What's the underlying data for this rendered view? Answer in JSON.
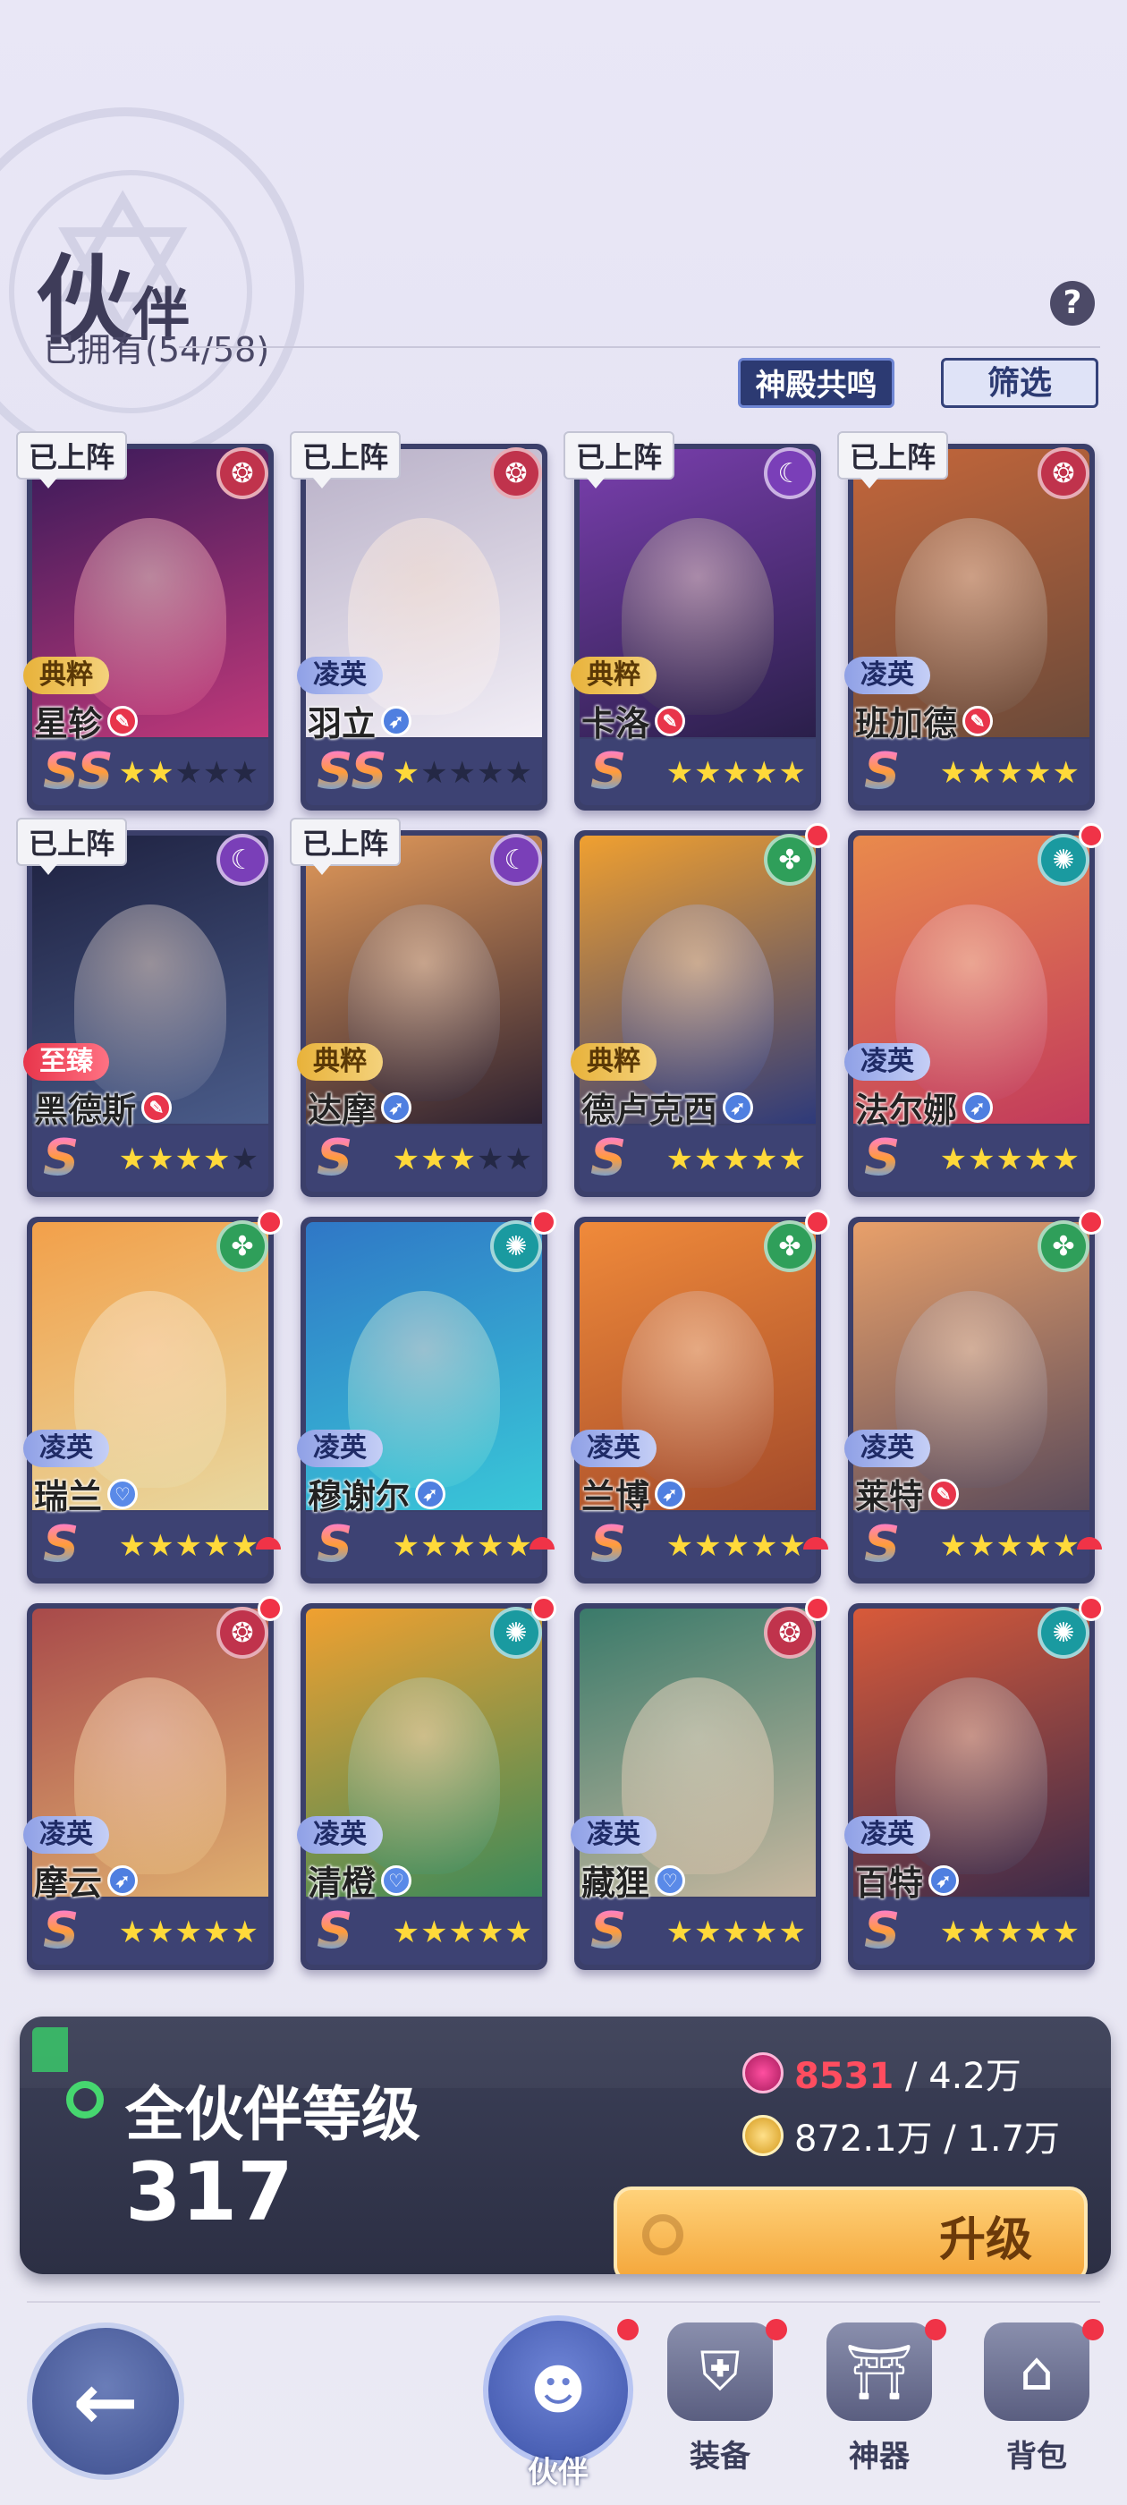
{
  "header": {
    "title_big": "伙",
    "title_small": "伴",
    "owned_label": "已拥有(54/58)",
    "temple_button": "神殿共鸣",
    "filter_button": "筛选",
    "help_icon": "?"
  },
  "deployed_label": "已上阵",
  "cards": [
    {
      "name": "星轸",
      "rank": "典粹",
      "rank_style": "gold",
      "deployed": true,
      "grade": "SS",
      "stars": 2,
      "max_stars": 5,
      "faction": "red",
      "role": "red",
      "red_dot": false,
      "art": [
        "#3a1a5a",
        "#c0397a"
      ]
    },
    {
      "name": "羽立",
      "rank": "凌英",
      "rank_style": "blue",
      "deployed": true,
      "grade": "SS",
      "stars": 1,
      "max_stars": 5,
      "faction": "red",
      "role": "blue",
      "red_dot": false,
      "art": [
        "#b9b1c8",
        "#f2eef6"
      ]
    },
    {
      "name": "卡洛",
      "rank": "典粹",
      "rank_style": "gold",
      "deployed": true,
      "grade": "S",
      "stars": 5,
      "max_stars": 5,
      "faction": "purple",
      "role": "red",
      "red_dot": false,
      "art": [
        "#7a3fae",
        "#2a1f4a"
      ]
    },
    {
      "name": "班加德",
      "rank": "凌英",
      "rank_style": "blue",
      "deployed": true,
      "grade": "S",
      "stars": 5,
      "max_stars": 5,
      "faction": "red",
      "role": "red",
      "red_dot": false,
      "art": [
        "#c4663a",
        "#6a4a3a"
      ]
    },
    {
      "name": "黑德斯",
      "rank": "至臻",
      "rank_style": "red",
      "deployed": true,
      "grade": "S",
      "stars": 4,
      "max_stars": 5,
      "faction": "purple",
      "role": "red",
      "red_dot": false,
      "art": [
        "#1e2140",
        "#4a5c8a"
      ]
    },
    {
      "name": "达摩",
      "rank": "典粹",
      "rank_style": "gold",
      "deployed": true,
      "grade": "S",
      "stars": 3,
      "max_stars": 5,
      "faction": "purple",
      "role": "blue",
      "red_dot": false,
      "art": [
        "#e39a5a",
        "#2c2030"
      ]
    },
    {
      "name": "德卢克西",
      "rank": "典粹",
      "rank_style": "gold",
      "deployed": false,
      "grade": "S",
      "stars": 5,
      "max_stars": 5,
      "faction": "green",
      "role": "blue",
      "red_dot": true,
      "art": [
        "#f0a030",
        "#2e3a7a"
      ]
    },
    {
      "name": "法尔娜",
      "rank": "凌英",
      "rank_style": "blue",
      "deployed": false,
      "grade": "S",
      "stars": 5,
      "max_stars": 5,
      "faction": "teal",
      "role": "blue",
      "red_dot": true,
      "art": [
        "#e98a4c",
        "#c23a5c"
      ]
    },
    {
      "name": "瑞兰",
      "rank": "凌英",
      "rank_style": "blue",
      "deployed": false,
      "grade": "S",
      "stars": 5,
      "max_stars": 5,
      "faction": "green",
      "role": "heart",
      "red_dot": true,
      "art": [
        "#f2a04a",
        "#e8d8a0"
      ]
    },
    {
      "name": "穆谢尔",
      "rank": "凌英",
      "rank_style": "blue",
      "deployed": false,
      "grade": "S",
      "stars": 5,
      "max_stars": 5,
      "faction": "teal",
      "role": "blue",
      "red_dot": true,
      "art": [
        "#2f77c6",
        "#39c8d8"
      ]
    },
    {
      "name": "兰博",
      "rank": "凌英",
      "rank_style": "blue",
      "deployed": false,
      "grade": "S",
      "stars": 5,
      "max_stars": 5,
      "faction": "green",
      "role": "blue",
      "red_dot": true,
      "art": [
        "#f08a3a",
        "#a34a2a"
      ]
    },
    {
      "name": "莱特",
      "rank": "凌英",
      "rank_style": "blue",
      "deployed": false,
      "grade": "S",
      "stars": 5,
      "max_stars": 5,
      "faction": "green",
      "role": "red",
      "red_dot": true,
      "art": [
        "#e8a06a",
        "#5a4a5a"
      ]
    },
    {
      "name": "摩云",
      "rank": "凌英",
      "rank_style": "blue",
      "deployed": false,
      "grade": "S",
      "stars": 5,
      "max_stars": 5,
      "faction": "red",
      "role": "blue",
      "red_dot": true,
      "art": [
        "#a84a4a",
        "#e0b070"
      ]
    },
    {
      "name": "清橙",
      "rank": "凌英",
      "rank_style": "blue",
      "deployed": false,
      "grade": "S",
      "stars": 5,
      "max_stars": 5,
      "faction": "teal",
      "role": "heart",
      "red_dot": true,
      "art": [
        "#f0a030",
        "#3a8a5a"
      ]
    },
    {
      "name": "藏狸",
      "rank": "凌英",
      "rank_style": "blue",
      "deployed": false,
      "grade": "S",
      "stars": 5,
      "max_stars": 5,
      "faction": "red",
      "role": "heart",
      "red_dot": true,
      "art": [
        "#3a7a6a",
        "#c8b8a0"
      ]
    },
    {
      "name": "百特",
      "rank": "凌英",
      "rank_style": "blue",
      "deployed": false,
      "grade": "S",
      "stars": 5,
      "max_stars": 5,
      "faction": "teal",
      "role": "blue",
      "red_dot": true,
      "art": [
        "#d85a3a",
        "#3a2a4a"
      ]
    }
  ],
  "level_panel": {
    "title": "全伙伴等级",
    "level": "317",
    "gem_need": "8531",
    "gem_have": " / 4.2万",
    "coin_need": "872.1万",
    "coin_have": " / 1.7万",
    "upgrade_label": "升级"
  },
  "nav": {
    "back_icon": "←",
    "tabs": [
      {
        "label": "伙伴",
        "icon": "partner-icon",
        "glyph": "☻",
        "active": true
      },
      {
        "label": "装备",
        "icon": "armor-icon",
        "glyph": "⛨",
        "active": false
      },
      {
        "label": "神器",
        "icon": "artifact-icon",
        "glyph": "⛩",
        "active": false
      },
      {
        "label": "背包",
        "icon": "backpack-icon",
        "glyph": "⌂",
        "active": false
      }
    ]
  },
  "colors": {
    "faction_red": "#c0334c",
    "faction_purple": "#7a3fb8",
    "faction_green": "#2f9f5a",
    "faction_teal": "#1a9aa0",
    "role_red": "#e8354b",
    "role_blue": "#4f7fe0",
    "role_heart": "#5a8ae8"
  }
}
